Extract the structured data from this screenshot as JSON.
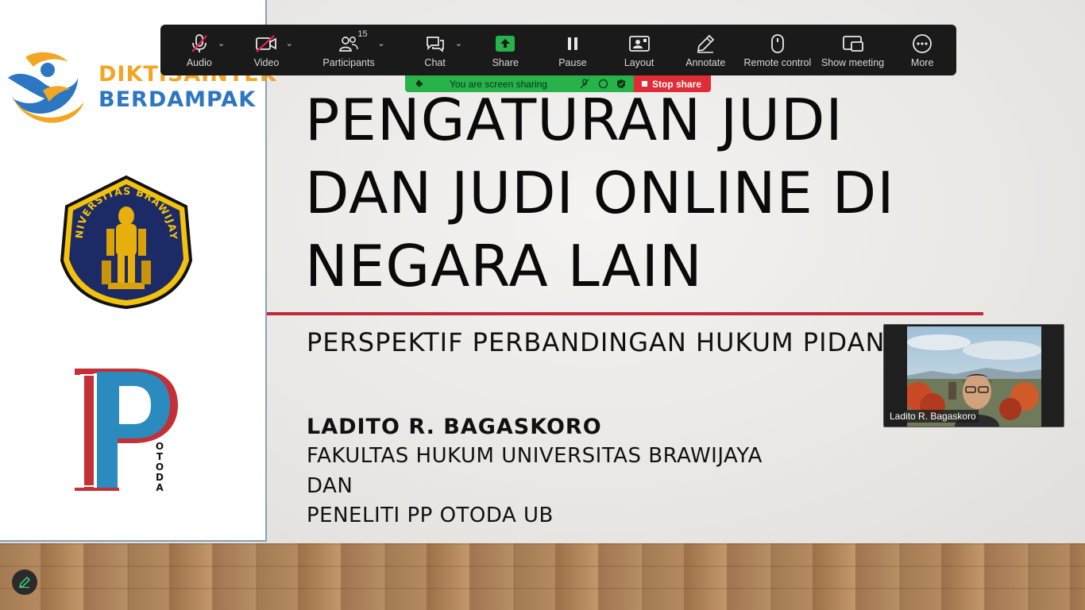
{
  "toolbar": {
    "audio": "Audio",
    "video": "Video",
    "participants": "Participants",
    "participants_count": "15",
    "chat": "Chat",
    "share": "Share",
    "pause": "Pause",
    "layout": "Layout",
    "annotate": "Annotate",
    "remote_control": "Remote control",
    "show_meeting": "Show meeting",
    "more": "More"
  },
  "share_banner": {
    "status": "You are screen sharing",
    "stop_label": "Stop share"
  },
  "slide": {
    "logo_line1": "DIKTISAINTEK",
    "logo_line2": "BERDAMPAK",
    "ub_logo_text": "UNIVERSITAS BRAWIJAYA",
    "otoda_text": "OTODA",
    "title_lines": [
      "PENGATURAN JUDI",
      "DAN JUDI ONLINE DI",
      "NEGARA LAIN"
    ],
    "subtitle": "PERSPEKTIF PERBANDINGAN HUKUM PIDANA",
    "author": "LADITO R. BAGASKORO",
    "affiliation_lines": [
      "FAKULTAS HUKUM UNIVERSITAS BRAWIJAYA",
      "DAN",
      "PENELITI PP OTODA UB"
    ]
  },
  "video_tile": {
    "participant_name": "Ladito R. Bagaskoro"
  },
  "colors": {
    "accent_rule": "#c2283a",
    "share_green": "#27b24a",
    "stop_red": "#e02c36",
    "toolbar_bg": "#1a1a1a",
    "muted_slash": "#e0244a"
  }
}
